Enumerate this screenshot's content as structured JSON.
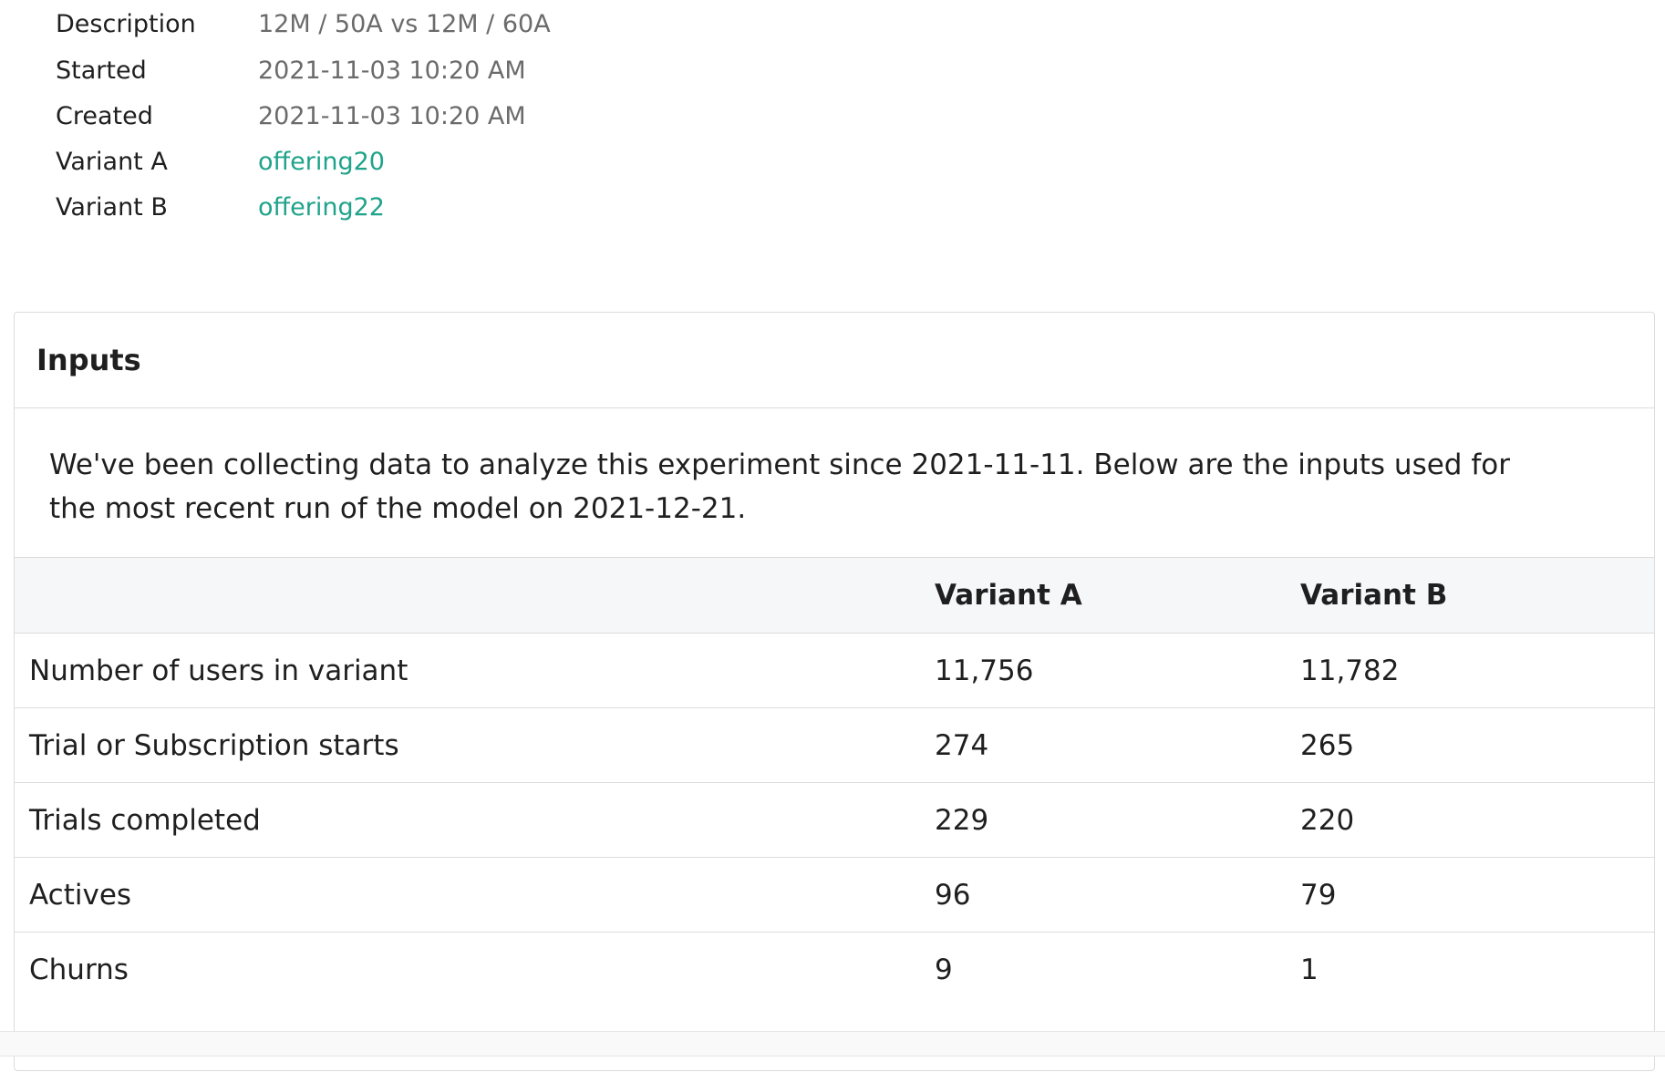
{
  "meta": {
    "rows": [
      {
        "label": "Description",
        "value": "12M / 50A vs 12M / 60A"
      },
      {
        "label": "Started",
        "value": "2021-11-03 10:20 AM"
      },
      {
        "label": "Created",
        "value": "2021-11-03 10:20 AM"
      },
      {
        "label": "Variant A",
        "value": "offering20"
      },
      {
        "label": "Variant B",
        "value": "offering22"
      }
    ],
    "link_color": "#1fa38a"
  },
  "inputs": {
    "title": "Inputs",
    "intro": "We've been collecting data to analyze this experiment since 2021-11-11. Below are the inputs used for the most recent run of the model on 2021-12-21.",
    "table": {
      "headers": [
        "",
        "Variant A",
        "Variant B"
      ],
      "rows": [
        {
          "label": "Number of users in variant",
          "a": "11,756",
          "b": "11,782"
        },
        {
          "label": "Trial or Subscription starts",
          "a": "274",
          "b": "265"
        },
        {
          "label": "Trials completed",
          "a": "229",
          "b": "220"
        },
        {
          "label": "Actives",
          "a": "96",
          "b": "79"
        },
        {
          "label": "Churns",
          "a": "9",
          "b": "1"
        }
      ]
    }
  }
}
